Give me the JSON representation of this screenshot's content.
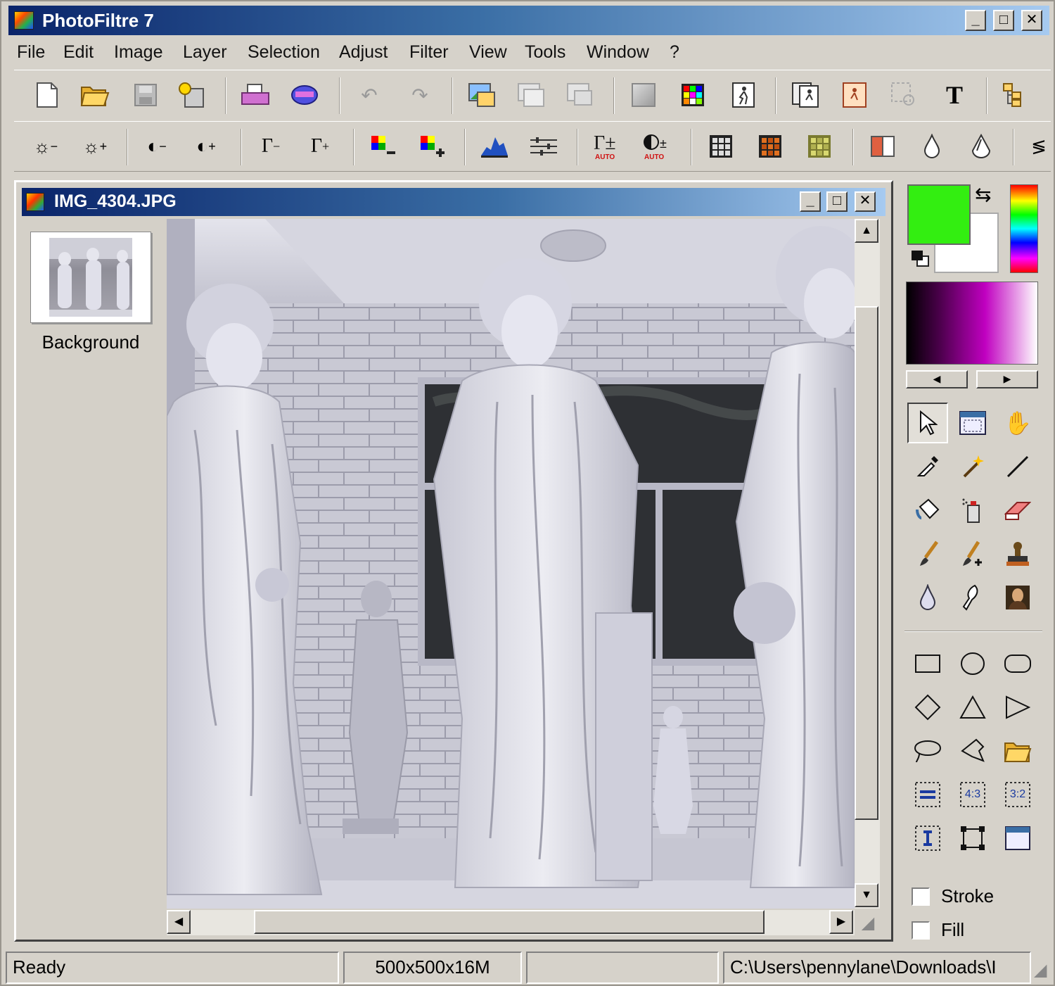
{
  "window": {
    "title": "PhotoFiltre 7"
  },
  "menu": [
    "File",
    "Edit",
    "Image",
    "Layer",
    "Selection",
    "Adjust",
    "Filter",
    "View",
    "Tools",
    "Window",
    "?"
  ],
  "toolbar1": {
    "text_tool_label": "T"
  },
  "document": {
    "title": "IMG_4304.JPG",
    "layers": [
      {
        "name": "Background"
      }
    ]
  },
  "tools": {
    "stroke_label": "Stroke",
    "fill_label": "Fill",
    "ratio_43": "4:3",
    "ratio_32": "3:2"
  },
  "colors": {
    "foreground": "#33ee11",
    "background": "#ffffff"
  },
  "status": {
    "message": "Ready",
    "image_info": "500x500x16M",
    "extra": "",
    "path": "C:\\Users\\pennylane\\Downloads\\I"
  }
}
